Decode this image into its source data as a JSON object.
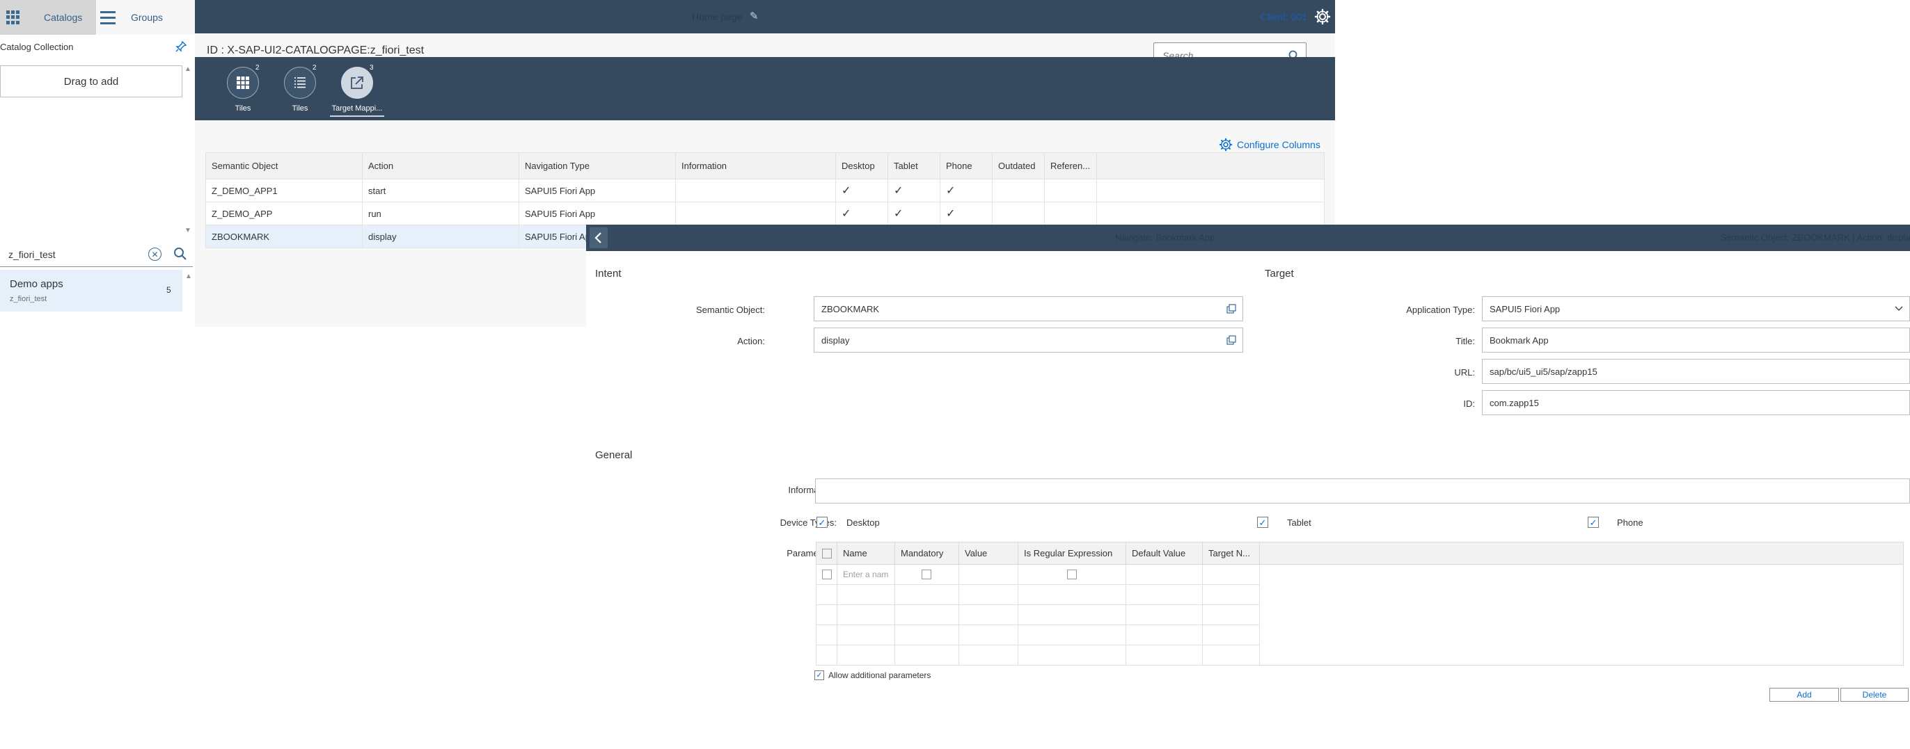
{
  "left_pane": {
    "catalogs_label": "Catalogs",
    "groups_label": "Groups",
    "collection_title": "Catalog Collection",
    "drag_to_add": "Drag to add",
    "search_value": "z_fiori_test",
    "results": [
      {
        "title": "Demo apps",
        "subtitle": "z_fiori_test",
        "count": "5"
      }
    ]
  },
  "shell": {
    "title": "Home page",
    "client": "Client: 001"
  },
  "catalog": {
    "id_label": "ID : X-SAP-UI2-CATALOGPAGE:z_fiori_test",
    "search_placeholder": "Search",
    "tabs": [
      {
        "label": "Tiles",
        "count": "2",
        "icon": "grid-icon"
      },
      {
        "label": "Tiles",
        "count": "2",
        "icon": "list-icon"
      },
      {
        "label": "Target Mappi...",
        "count": "3",
        "icon": "share-icon"
      }
    ],
    "configure_columns": "Configure Columns",
    "columns": [
      "Semantic Object",
      "Action",
      "Navigation Type",
      "Information",
      "Desktop",
      "Tablet",
      "Phone",
      "Outdated",
      "Referen..."
    ],
    "rows": [
      {
        "semantic_object": "Z_DEMO_APP1",
        "action": "start",
        "navigation_type": "SAPUI5 Fiori App",
        "information": "",
        "desktop": "✓",
        "tablet": "✓",
        "phone": "✓",
        "outdated": "",
        "reference": ""
      },
      {
        "semantic_object": "Z_DEMO_APP",
        "action": "run",
        "navigation_type": "SAPUI5 Fiori App",
        "information": "",
        "desktop": "✓",
        "tablet": "✓",
        "phone": "✓",
        "outdated": "",
        "reference": ""
      },
      {
        "semantic_object": "ZBOOKMARK",
        "action": "display",
        "navigation_type": "SAPUI5 Fiori App",
        "information": "",
        "desktop": "",
        "tablet": "",
        "phone": "",
        "outdated": "",
        "reference": ""
      }
    ]
  },
  "detail": {
    "title": "Navigate: Bookmark App",
    "right_info": "Semantic Object: ZBOOKMARK | Action: display",
    "intent_title": "Intent",
    "target_title": "Target",
    "general_title": "General",
    "semantic_object_label": "Semantic Object:",
    "semantic_object_value": "ZBOOKMARK",
    "action_label": "Action:",
    "action_value": "display",
    "app_type_label": "Application Type:",
    "app_type_value": "SAPUI5 Fiori App",
    "title_label": "Title:",
    "title_value": "Bookmark App",
    "url_label": "URL:",
    "url_value": "sap/bc/ui5_ui5/sap/zapp15",
    "id_label": "ID:",
    "id_value": "com.zapp15",
    "information_label": "Information:",
    "information_value": "",
    "device_types_label": "Device Types:",
    "devices": [
      {
        "label": "Desktop",
        "checked": "✓"
      },
      {
        "label": "Tablet",
        "checked": "✓"
      },
      {
        "label": "Phone",
        "checked": "✓"
      }
    ],
    "parameters_label": "Parameters:",
    "param_columns": [
      "Name",
      "Mandatory",
      "Value",
      "Is Regular Expression",
      "Default Value",
      "Target N..."
    ],
    "param_name_placeholder": "Enter a nam",
    "allow_additional": "Allow additional parameters",
    "allow_checked": "✓",
    "add_button": "Add",
    "delete_button": "Delete"
  }
}
